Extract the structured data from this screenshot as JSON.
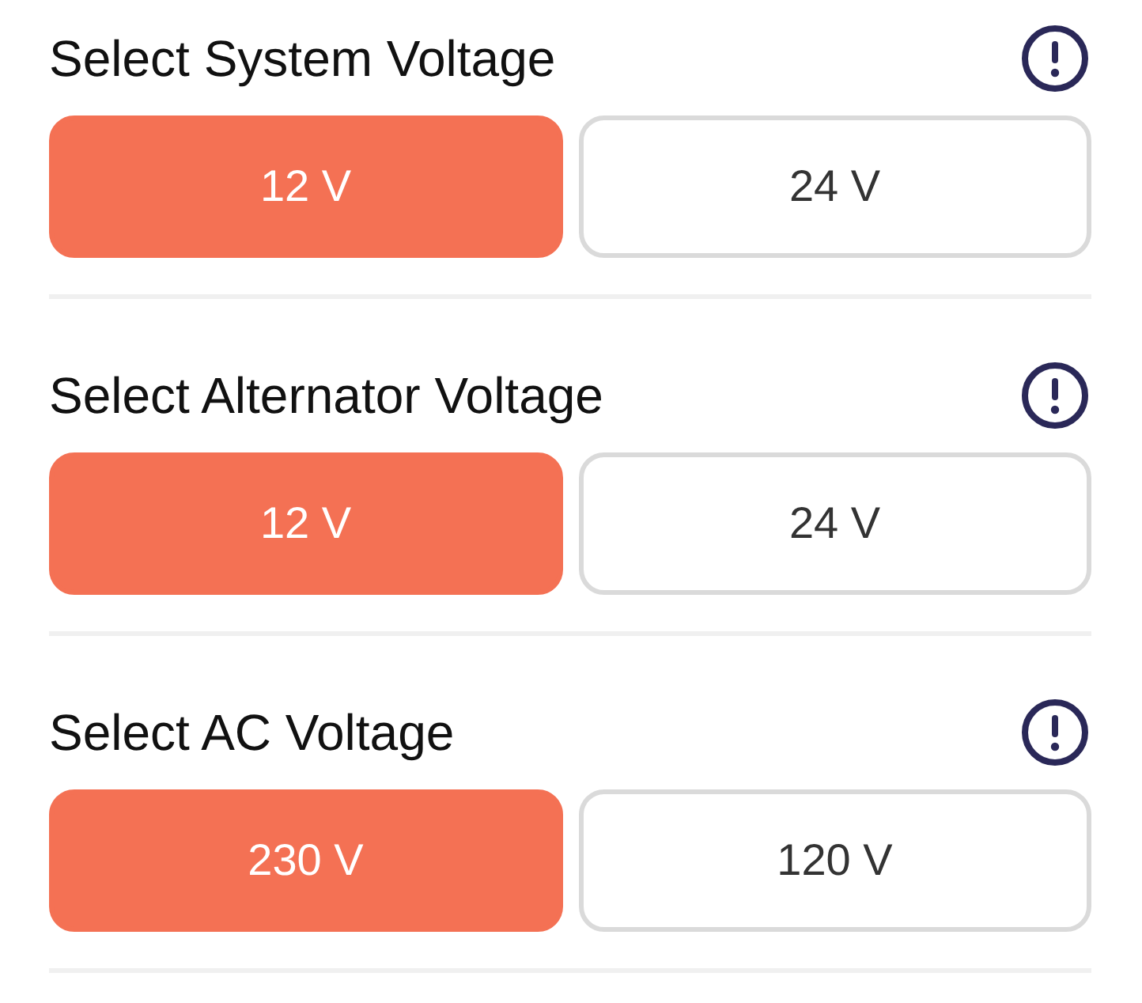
{
  "sections": [
    {
      "title": "Select System Voltage",
      "options": [
        {
          "label": "12 V",
          "selected": true
        },
        {
          "label": "24 V",
          "selected": false
        }
      ]
    },
    {
      "title": "Select Alternator Voltage",
      "options": [
        {
          "label": "12 V",
          "selected": true
        },
        {
          "label": "24 V",
          "selected": false
        }
      ]
    },
    {
      "title": "Select AC Voltage",
      "options": [
        {
          "label": "230 V",
          "selected": true
        },
        {
          "label": "120 V",
          "selected": false
        }
      ]
    }
  ]
}
